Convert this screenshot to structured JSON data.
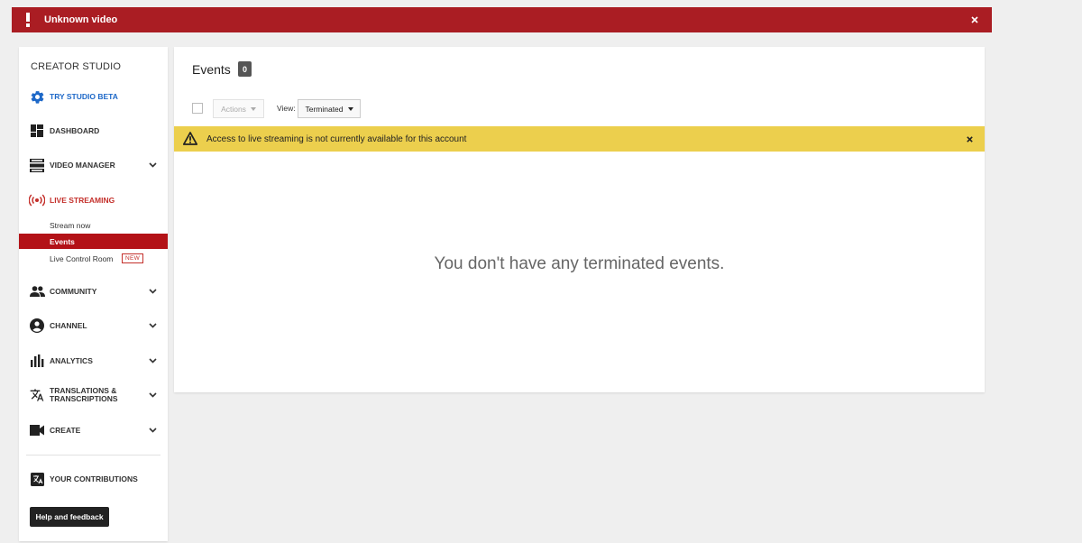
{
  "error_banner": {
    "title": "Unknown video"
  },
  "sidebar": {
    "heading": "CREATOR STUDIO",
    "try_beta": "TRY STUDIO BETA",
    "dashboard": "DASHBOARD",
    "video_manager": "VIDEO MANAGER",
    "live_streaming": "LIVE STREAMING",
    "sub_items": [
      "Stream now",
      "Events",
      "Live Control Room"
    ],
    "new_badge": "NEW",
    "community": "COMMUNITY",
    "channel": "CHANNEL",
    "analytics": "ANALYTICS",
    "translations_line1": "TRANSLATIONS &",
    "translations_line2": "TRANSCRIPTIONS",
    "create": "CREATE",
    "your_contributions": "YOUR CONTRIBUTIONS",
    "help_button": "Help and feedback"
  },
  "main": {
    "title": "Events",
    "count": "0",
    "actions_label": "Actions",
    "view_label": "View:",
    "view_value": "Terminated",
    "warning": "Access to live streaming is not currently available for this account",
    "empty_message": "You don't have any terminated events."
  },
  "colors": {
    "error_red": "#aa1d23",
    "active_red": "#b31217",
    "beta_blue": "#1d68c8",
    "warning_yellow": "#eccf4d"
  }
}
